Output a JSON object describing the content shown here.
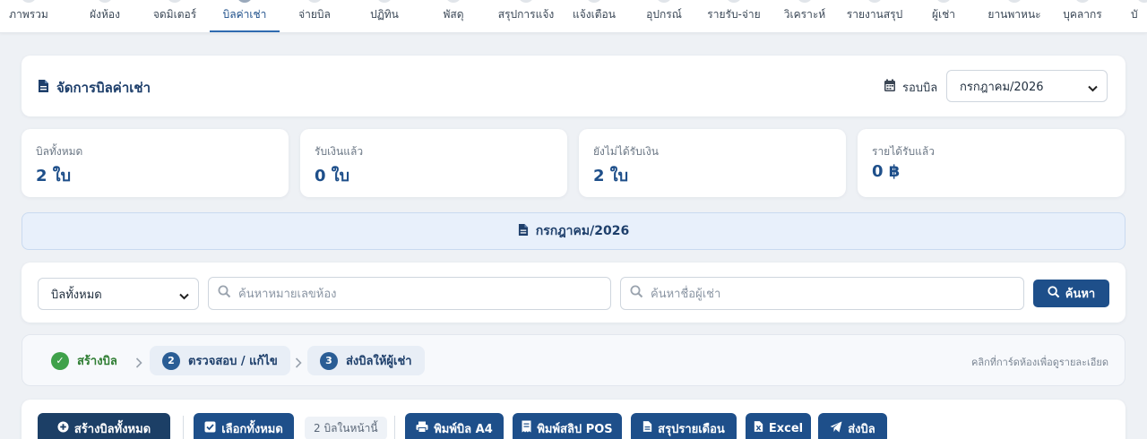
{
  "nav": {
    "items": [
      {
        "label": "ภาพรวม"
      },
      {
        "label": "ผังห้อง"
      },
      {
        "label": "จดมิเตอร์"
      },
      {
        "label": "บิลค่าเช่า"
      },
      {
        "label": "จ่ายบิล"
      },
      {
        "label": "ปฏิทิน"
      },
      {
        "label": "พัสดุ"
      },
      {
        "label": "สรุปการแจ้ง"
      },
      {
        "label": "แจ้งเตือน"
      },
      {
        "label": "อุปกรณ์"
      },
      {
        "label": "รายรับ-จ่าย"
      },
      {
        "label": "วิเคราะห์"
      },
      {
        "label": "รายงานสรุป"
      },
      {
        "label": "ผู้เช่า"
      },
      {
        "label": "ยานพาหนะ"
      },
      {
        "label": "บุคลากร"
      },
      {
        "label": "บั"
      }
    ],
    "active_index": 3
  },
  "header": {
    "title": "จัดการบิลค่าเช่า",
    "round_label": "รอบบิล",
    "round_value": "กรกฎาคม/2026"
  },
  "stats": [
    {
      "label": "บิลทั้งหมด",
      "value": "2 ใบ"
    },
    {
      "label": "รับเงินแล้ว",
      "value": "0 ใบ"
    },
    {
      "label": "ยังไม่ได้รับเงิน",
      "value": "2 ใบ"
    },
    {
      "label": "รายได้รับแล้ว",
      "value": "0 ฿"
    }
  ],
  "banner": {
    "month": "กรกฎาคม/2026"
  },
  "filter": {
    "status_value": "บิลทั้งหมด",
    "room_placeholder": "ค้นหาหมายเลขห้อง",
    "tenant_placeholder": "ค้นหาชื่อผู้เช่า",
    "search_label": "ค้นหา"
  },
  "steps": {
    "items": [
      {
        "number": "✓",
        "label": "สร้างบิล",
        "state": "done"
      },
      {
        "number": "2",
        "label": "ตรวจสอบ / แก้ไข",
        "state": "pending"
      },
      {
        "number": "3",
        "label": "ส่งบิลให้ผู้เช่า",
        "state": "pending"
      }
    ],
    "hint": "คลิกที่การ์ดห้องเพื่อดูรายละเอียด"
  },
  "actions": {
    "create_all": "สร้างบิลทั้งหมด",
    "select_all": "เลือกทั้งหมด",
    "count_on_page": "2 บิลในหน้านี้",
    "print_a4": "พิมพ์บิล A4",
    "print_pos": "พิมพ์สลิป POS",
    "monthly_summary": "สรุปรายเดือน",
    "excel": "Excel",
    "send_bill": "ส่งบิล"
  },
  "colors": {
    "primary": "#1e4f8a",
    "success": "#3fa14a",
    "banner_bg": "#e8f0fb"
  }
}
